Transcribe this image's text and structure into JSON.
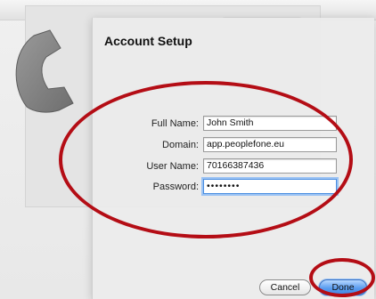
{
  "dialog": {
    "title": "Account Setup"
  },
  "form": {
    "full_name": {
      "label": "Full Name:",
      "value": "John Smith"
    },
    "domain": {
      "label": "Domain:",
      "value": "app.peoplefone.eu"
    },
    "user_name": {
      "label": "User Name:",
      "value": "70166387436"
    },
    "password": {
      "label": "Password:",
      "value": "••••••••"
    }
  },
  "buttons": {
    "cancel": "Cancel",
    "done": "Done"
  },
  "colors": {
    "highlight": "#b40d15",
    "focus": "#4a8ee0",
    "primary_button": "#5b9df0"
  },
  "icons": {
    "app": "phone-handset-icon"
  }
}
